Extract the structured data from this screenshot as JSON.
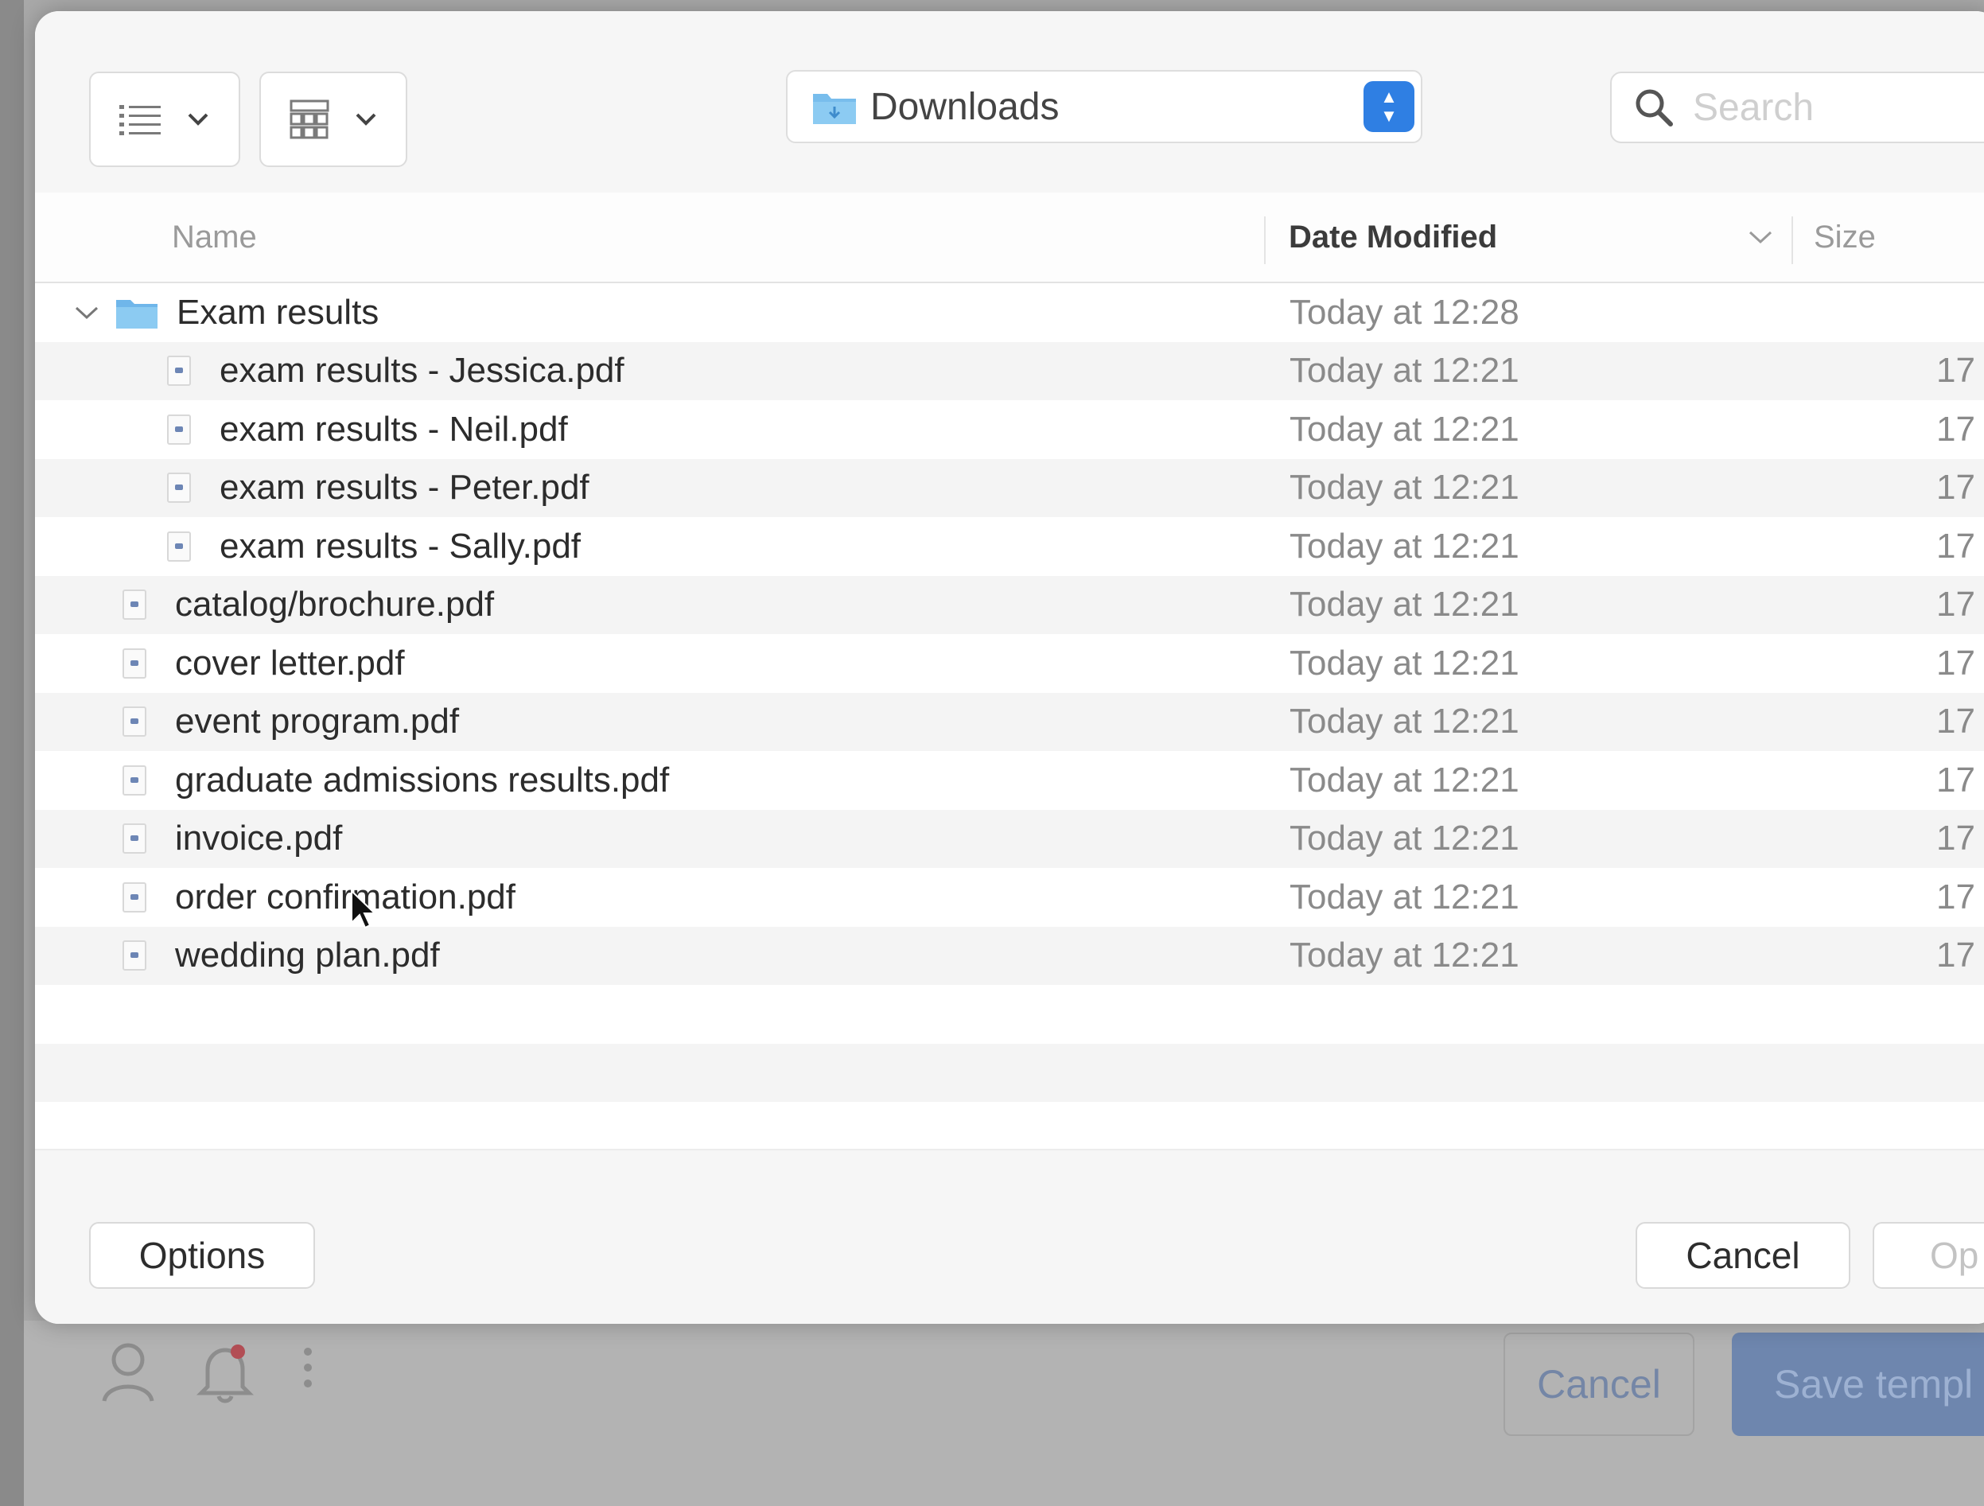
{
  "toolbar": {
    "view_list_icon": "list-icon",
    "view_grid_icon": "grid-icon",
    "location": "Downloads",
    "search_placeholder": "Search"
  },
  "columns": {
    "name": "Name",
    "date_modified": "Date Modified",
    "size": "Size"
  },
  "files": [
    {
      "name": "Exam results",
      "date": "Today at 12:28",
      "size": "",
      "type": "folder",
      "expanded": true,
      "indent": 0
    },
    {
      "name": "exam results - Jessica.pdf",
      "date": "Today at 12:21",
      "size": "17",
      "type": "pdf",
      "indent": 1
    },
    {
      "name": "exam results - Neil.pdf",
      "date": "Today at 12:21",
      "size": "17",
      "type": "pdf",
      "indent": 1
    },
    {
      "name": "exam results - Peter.pdf",
      "date": "Today at 12:21",
      "size": "17",
      "type": "pdf",
      "indent": 1
    },
    {
      "name": "exam results - Sally.pdf",
      "date": "Today at 12:21",
      "size": "17",
      "type": "pdf",
      "indent": 1
    },
    {
      "name": "catalog/brochure.pdf",
      "date": "Today at 12:21",
      "size": "17",
      "type": "pdf",
      "indent": 0
    },
    {
      "name": "cover letter.pdf",
      "date": "Today at 12:21",
      "size": "17",
      "type": "pdf",
      "indent": 0
    },
    {
      "name": "event program.pdf",
      "date": "Today at 12:21",
      "size": "17",
      "type": "pdf",
      "indent": 0
    },
    {
      "name": "graduate admissions results.pdf",
      "date": "Today at 12:21",
      "size": "17",
      "type": "pdf",
      "indent": 0
    },
    {
      "name": "invoice.pdf",
      "date": "Today at 12:21",
      "size": "17",
      "type": "pdf",
      "indent": 0
    },
    {
      "name": "order confirmation.pdf",
      "date": "Today at 12:21",
      "size": "17",
      "type": "pdf",
      "indent": 0
    },
    {
      "name": "wedding plan.pdf",
      "date": "Today at 12:21",
      "size": "17",
      "type": "pdf",
      "indent": 0
    }
  ],
  "footer": {
    "options_label": "Options",
    "cancel_label": "Cancel",
    "open_label": "Op"
  },
  "background": {
    "cancel_label": "Cancel",
    "save_label": "Save templ"
  },
  "colors": {
    "accent": "#2f7fe3",
    "folder": "#6fb6ea"
  }
}
